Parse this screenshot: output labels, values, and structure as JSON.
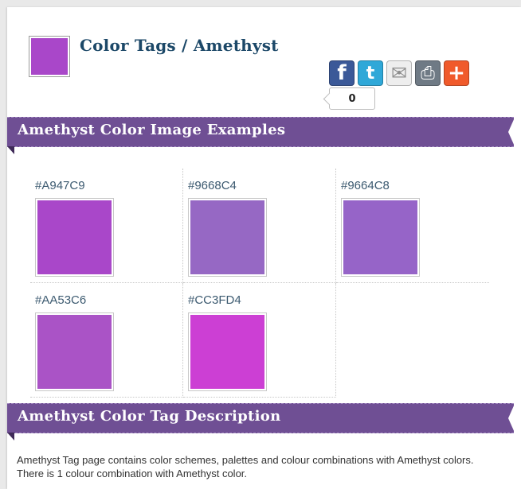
{
  "header": {
    "title": "Color Tags / Amethyst",
    "swatch_color": "#A947C9"
  },
  "share": {
    "buttons": [
      {
        "icon": "facebook-icon",
        "glyph": "f",
        "color": "#3b5998"
      },
      {
        "icon": "twitter-icon",
        "glyph": "t",
        "color": "#2fa8d8"
      },
      {
        "icon": "email-icon",
        "glyph": "✉",
        "color": "#eeeeee"
      },
      {
        "icon": "print-icon",
        "glyph": "⎙",
        "color": "#6f7a85"
      },
      {
        "icon": "plus-icon",
        "glyph": "+",
        "color": "#f05a2b"
      }
    ],
    "count": "0"
  },
  "sections": {
    "examples_title": "Amethyst Color Image Examples",
    "description_title": "Amethyst Color Tag Description"
  },
  "examples": [
    {
      "label": "#A947C9",
      "color": "#A947C9"
    },
    {
      "label": "#9668C4",
      "color": "#9668C4"
    },
    {
      "label": "#9664C8",
      "color": "#9664C8"
    },
    {
      "label": "#AA53C6",
      "color": "#AA53C6"
    },
    {
      "label": "#CC3FD4",
      "color": "#CC3FD4"
    }
  ],
  "description": "Amethyst Tag page contains color schemes, palettes and colour combinations with Amethyst colors. There is 1 colour combination with Amethyst color."
}
